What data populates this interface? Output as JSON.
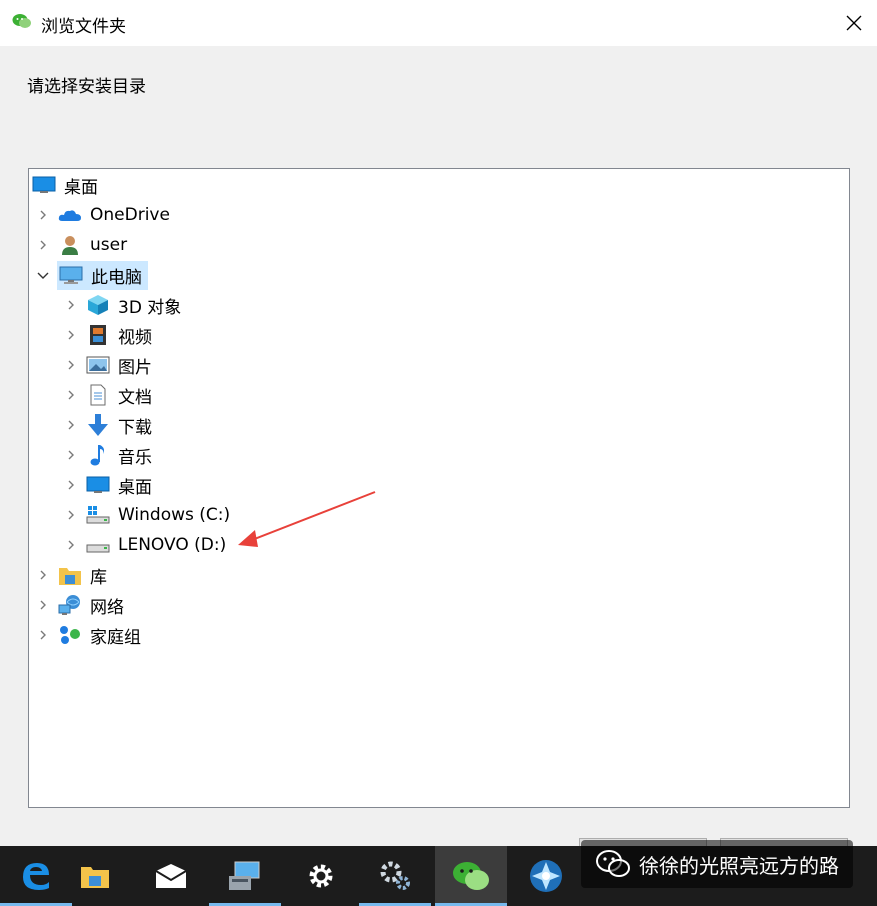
{
  "window": {
    "title": "浏览文件夹",
    "prompt": "请选择安装目录"
  },
  "tree": [
    {
      "label": "桌面",
      "icon": "desktop-icon",
      "expander": "none"
    },
    {
      "label": "OneDrive",
      "icon": "onedrive-icon",
      "expander": "collapsed"
    },
    {
      "label": "user",
      "icon": "user-icon",
      "expander": "collapsed"
    },
    {
      "label": "此电脑",
      "icon": "this-pc-icon",
      "expander": "expanded",
      "selected": true
    },
    {
      "label": "3D 对象",
      "icon": "3d-objects-icon",
      "expander": "collapsed"
    },
    {
      "label": "视频",
      "icon": "videos-icon",
      "expander": "collapsed"
    },
    {
      "label": "图片",
      "icon": "pictures-icon",
      "expander": "collapsed"
    },
    {
      "label": "文档",
      "icon": "documents-icon",
      "expander": "collapsed"
    },
    {
      "label": "下载",
      "icon": "downloads-icon",
      "expander": "collapsed"
    },
    {
      "label": "音乐",
      "icon": "music-icon",
      "expander": "collapsed"
    },
    {
      "label": "桌面",
      "icon": "desktop-icon",
      "expander": "collapsed"
    },
    {
      "label": "Windows (C:)",
      "icon": "windows-drive-icon",
      "expander": "collapsed"
    },
    {
      "label": "LENOVO (D:)",
      "icon": "drive-icon",
      "expander": "collapsed"
    },
    {
      "label": "库",
      "icon": "libraries-icon",
      "expander": "collapsed"
    },
    {
      "label": "网络",
      "icon": "network-icon",
      "expander": "collapsed"
    },
    {
      "label": "家庭组",
      "icon": "homegroup-icon",
      "expander": "collapsed"
    }
  ],
  "taskbar": {
    "items": [
      {
        "name": "edge-icon"
      },
      {
        "name": "file-explorer-icon"
      },
      {
        "name": "mail-icon"
      },
      {
        "name": "control-panel-icon"
      },
      {
        "name": "settings-gear-icon"
      },
      {
        "name": "settings-gears-icon"
      },
      {
        "name": "wechat-icon",
        "active": true
      },
      {
        "name": "app-icon"
      }
    ]
  },
  "watermark": {
    "text": "徐徐的光照亮远方的路"
  },
  "colors": {
    "selection": "#cce8ff",
    "annotation_arrow": "#e8413a",
    "taskbar": "#1c1c1c"
  }
}
